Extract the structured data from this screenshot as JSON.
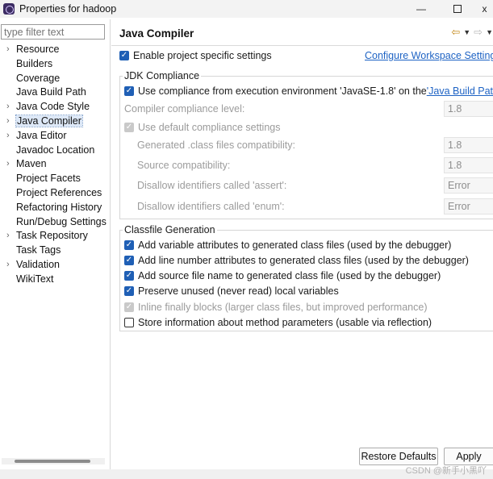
{
  "window": {
    "title": "Properties for hadoop",
    "minimize": "—",
    "close": "x"
  },
  "left": {
    "filter_placeholder": "type filter text",
    "items": [
      {
        "label": "Resource",
        "arrow": "›"
      },
      {
        "label": "Builders",
        "arrow": ""
      },
      {
        "label": "Coverage",
        "arrow": ""
      },
      {
        "label": "Java Build Path",
        "arrow": ""
      },
      {
        "label": "Java Code Style",
        "arrow": "›"
      },
      {
        "label": "Java Compiler",
        "arrow": "›",
        "selected": true
      },
      {
        "label": "Java Editor",
        "arrow": "›"
      },
      {
        "label": "Javadoc Location",
        "arrow": ""
      },
      {
        "label": "Maven",
        "arrow": "›"
      },
      {
        "label": "Project Facets",
        "arrow": ""
      },
      {
        "label": "Project References",
        "arrow": ""
      },
      {
        "label": "Refactoring History",
        "arrow": ""
      },
      {
        "label": "Run/Debug Settings",
        "arrow": ""
      },
      {
        "label": "Task Repository",
        "arrow": "›"
      },
      {
        "label": "Task Tags",
        "arrow": ""
      },
      {
        "label": "Validation",
        "arrow": "›"
      },
      {
        "label": "WikiText",
        "arrow": ""
      }
    ]
  },
  "main": {
    "title": "Java Compiler",
    "nav": {
      "back": "⇦",
      "forward": "⇨",
      "dropdown": "▼"
    },
    "enable_label": "Enable project specific settings",
    "configure_link": "Configure Workspace Settings...",
    "jdk": {
      "group_title": "JDK Compliance",
      "use_compliance_prefix": "Use compliance from execution environment 'JavaSE-1.8' on the ",
      "use_compliance_link": "'Java Build Path'",
      "compiler_level_label": "Compiler compliance level:",
      "compiler_level_value": "1.8",
      "use_default_label": "Use default compliance settings",
      "generated_label": "Generated .class files compatibility:",
      "generated_value": "1.8",
      "source_label": "Source compatibility:",
      "source_value": "1.8",
      "assert_label": "Disallow identifiers called 'assert':",
      "assert_value": "Error",
      "enum_label": "Disallow identifiers called 'enum':",
      "enum_value": "Error"
    },
    "classfile": {
      "group_title": "Classfile Generation",
      "items": [
        "Add variable attributes to generated class files (used by the debugger)",
        "Add line number attributes to generated class files (used by the debugger)",
        "Add source file name to generated class file (used by the debugger)",
        "Preserve unused (never read) local variables",
        "Inline finally blocks (larger class files, but improved performance)",
        "Store information about method parameters (usable via reflection)"
      ]
    },
    "buttons": {
      "restore": "Restore Defaults",
      "apply": "Apply"
    }
  },
  "watermark": "CSDN @新手小黑吖",
  "checkmark": "✓"
}
